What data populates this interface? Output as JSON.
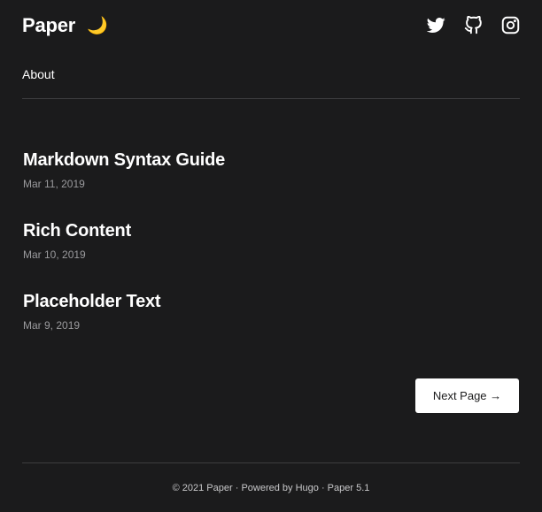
{
  "header": {
    "brand": "Paper",
    "theme_toggle_glyph": "🌙",
    "social_icons": [
      "twitter-icon",
      "github-icon",
      "instagram-icon"
    ]
  },
  "nav": {
    "about_label": "About"
  },
  "posts": [
    {
      "title": "Markdown Syntax Guide",
      "date": "Mar 11, 2019"
    },
    {
      "title": "Rich Content",
      "date": "Mar 10, 2019"
    },
    {
      "title": "Placeholder Text",
      "date": "Mar 9, 2019"
    }
  ],
  "pagination": {
    "next_label": "Next Page →"
  },
  "footer": {
    "copyright": "© 2021 Paper",
    "sep1": " · ",
    "powered_by": "Powered by Hugo",
    "sep2": " · ",
    "theme_version": "Paper 5.1"
  },
  "colors": {
    "background": "#1b1b1c",
    "text": "#ffffff",
    "muted": "#9a9a9d",
    "divider": "#3d3d3f"
  }
}
